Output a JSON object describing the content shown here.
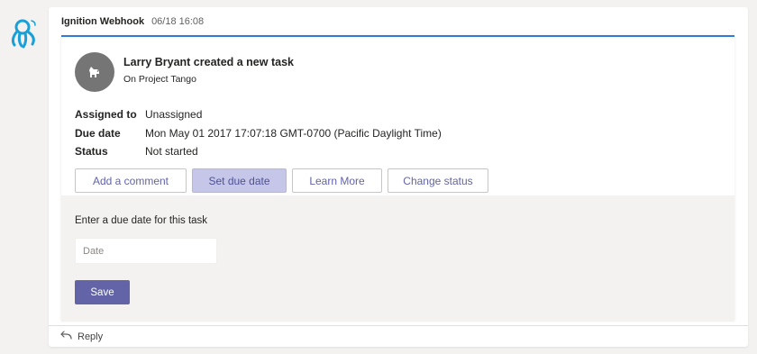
{
  "message": {
    "sender": "Ignition Webhook",
    "timestamp": "06/18 16:08",
    "bot_icon": "octopus-logo-icon"
  },
  "card": {
    "avatar_icon": "dog-avatar-icon",
    "title": "Larry Bryant created a new task",
    "subtitle": "On Project Tango",
    "facts": [
      {
        "key": "Assigned to",
        "value": "Unassigned"
      },
      {
        "key": "Due date",
        "value": "Mon May 01 2017 17:07:18 GMT-0700 (Pacific Daylight Time)"
      },
      {
        "key": "Status",
        "value": "Not started"
      }
    ],
    "actions": [
      "Add a comment",
      "Set due date",
      "Learn More",
      "Change status"
    ],
    "active_action": "Set due date",
    "due_form": {
      "prompt": "Enter a due date for this task",
      "placeholder": "Date",
      "value": "",
      "save_label": "Save"
    }
  },
  "reply": {
    "label": "Reply",
    "icon": "reply-arrow-icon"
  },
  "colors": {
    "accent": "#6264a7",
    "card_border": "#2f7bd9",
    "bot_blue": "#1aa0d8"
  }
}
